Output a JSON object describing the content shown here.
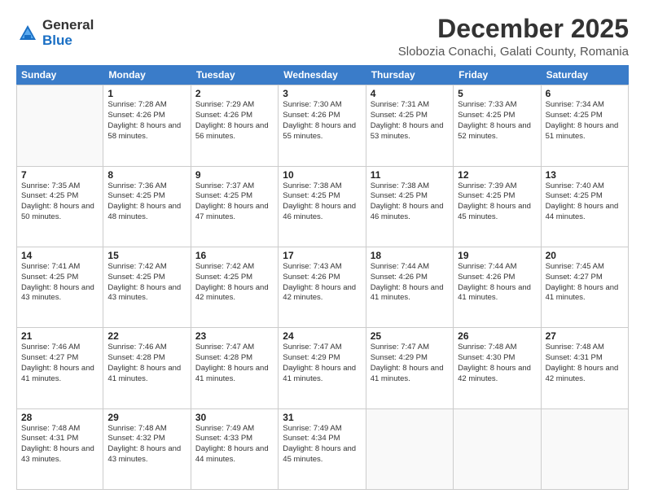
{
  "logo": {
    "general": "General",
    "blue": "Blue"
  },
  "title": "December 2025",
  "subtitle": "Slobozia Conachi, Galati County, Romania",
  "days": [
    "Sunday",
    "Monday",
    "Tuesday",
    "Wednesday",
    "Thursday",
    "Friday",
    "Saturday"
  ],
  "weeks": [
    [
      {
        "day": "",
        "sunrise": "",
        "sunset": "",
        "daylight": ""
      },
      {
        "day": "1",
        "sunrise": "Sunrise: 7:28 AM",
        "sunset": "Sunset: 4:26 PM",
        "daylight": "Daylight: 8 hours and 58 minutes."
      },
      {
        "day": "2",
        "sunrise": "Sunrise: 7:29 AM",
        "sunset": "Sunset: 4:26 PM",
        "daylight": "Daylight: 8 hours and 56 minutes."
      },
      {
        "day": "3",
        "sunrise": "Sunrise: 7:30 AM",
        "sunset": "Sunset: 4:26 PM",
        "daylight": "Daylight: 8 hours and 55 minutes."
      },
      {
        "day": "4",
        "sunrise": "Sunrise: 7:31 AM",
        "sunset": "Sunset: 4:25 PM",
        "daylight": "Daylight: 8 hours and 53 minutes."
      },
      {
        "day": "5",
        "sunrise": "Sunrise: 7:33 AM",
        "sunset": "Sunset: 4:25 PM",
        "daylight": "Daylight: 8 hours and 52 minutes."
      },
      {
        "day": "6",
        "sunrise": "Sunrise: 7:34 AM",
        "sunset": "Sunset: 4:25 PM",
        "daylight": "Daylight: 8 hours and 51 minutes."
      }
    ],
    [
      {
        "day": "7",
        "sunrise": "Sunrise: 7:35 AM",
        "sunset": "Sunset: 4:25 PM",
        "daylight": "Daylight: 8 hours and 50 minutes."
      },
      {
        "day": "8",
        "sunrise": "Sunrise: 7:36 AM",
        "sunset": "Sunset: 4:25 PM",
        "daylight": "Daylight: 8 hours and 48 minutes."
      },
      {
        "day": "9",
        "sunrise": "Sunrise: 7:37 AM",
        "sunset": "Sunset: 4:25 PM",
        "daylight": "Daylight: 8 hours and 47 minutes."
      },
      {
        "day": "10",
        "sunrise": "Sunrise: 7:38 AM",
        "sunset": "Sunset: 4:25 PM",
        "daylight": "Daylight: 8 hours and 46 minutes."
      },
      {
        "day": "11",
        "sunrise": "Sunrise: 7:38 AM",
        "sunset": "Sunset: 4:25 PM",
        "daylight": "Daylight: 8 hours and 46 minutes."
      },
      {
        "day": "12",
        "sunrise": "Sunrise: 7:39 AM",
        "sunset": "Sunset: 4:25 PM",
        "daylight": "Daylight: 8 hours and 45 minutes."
      },
      {
        "day": "13",
        "sunrise": "Sunrise: 7:40 AM",
        "sunset": "Sunset: 4:25 PM",
        "daylight": "Daylight: 8 hours and 44 minutes."
      }
    ],
    [
      {
        "day": "14",
        "sunrise": "Sunrise: 7:41 AM",
        "sunset": "Sunset: 4:25 PM",
        "daylight": "Daylight: 8 hours and 43 minutes."
      },
      {
        "day": "15",
        "sunrise": "Sunrise: 7:42 AM",
        "sunset": "Sunset: 4:25 PM",
        "daylight": "Daylight: 8 hours and 43 minutes."
      },
      {
        "day": "16",
        "sunrise": "Sunrise: 7:42 AM",
        "sunset": "Sunset: 4:25 PM",
        "daylight": "Daylight: 8 hours and 42 minutes."
      },
      {
        "day": "17",
        "sunrise": "Sunrise: 7:43 AM",
        "sunset": "Sunset: 4:26 PM",
        "daylight": "Daylight: 8 hours and 42 minutes."
      },
      {
        "day": "18",
        "sunrise": "Sunrise: 7:44 AM",
        "sunset": "Sunset: 4:26 PM",
        "daylight": "Daylight: 8 hours and 41 minutes."
      },
      {
        "day": "19",
        "sunrise": "Sunrise: 7:44 AM",
        "sunset": "Sunset: 4:26 PM",
        "daylight": "Daylight: 8 hours and 41 minutes."
      },
      {
        "day": "20",
        "sunrise": "Sunrise: 7:45 AM",
        "sunset": "Sunset: 4:27 PM",
        "daylight": "Daylight: 8 hours and 41 minutes."
      }
    ],
    [
      {
        "day": "21",
        "sunrise": "Sunrise: 7:46 AM",
        "sunset": "Sunset: 4:27 PM",
        "daylight": "Daylight: 8 hours and 41 minutes."
      },
      {
        "day": "22",
        "sunrise": "Sunrise: 7:46 AM",
        "sunset": "Sunset: 4:28 PM",
        "daylight": "Daylight: 8 hours and 41 minutes."
      },
      {
        "day": "23",
        "sunrise": "Sunrise: 7:47 AM",
        "sunset": "Sunset: 4:28 PM",
        "daylight": "Daylight: 8 hours and 41 minutes."
      },
      {
        "day": "24",
        "sunrise": "Sunrise: 7:47 AM",
        "sunset": "Sunset: 4:29 PM",
        "daylight": "Daylight: 8 hours and 41 minutes."
      },
      {
        "day": "25",
        "sunrise": "Sunrise: 7:47 AM",
        "sunset": "Sunset: 4:29 PM",
        "daylight": "Daylight: 8 hours and 41 minutes."
      },
      {
        "day": "26",
        "sunrise": "Sunrise: 7:48 AM",
        "sunset": "Sunset: 4:30 PM",
        "daylight": "Daylight: 8 hours and 42 minutes."
      },
      {
        "day": "27",
        "sunrise": "Sunrise: 7:48 AM",
        "sunset": "Sunset: 4:31 PM",
        "daylight": "Daylight: 8 hours and 42 minutes."
      }
    ],
    [
      {
        "day": "28",
        "sunrise": "Sunrise: 7:48 AM",
        "sunset": "Sunset: 4:31 PM",
        "daylight": "Daylight: 8 hours and 43 minutes."
      },
      {
        "day": "29",
        "sunrise": "Sunrise: 7:48 AM",
        "sunset": "Sunset: 4:32 PM",
        "daylight": "Daylight: 8 hours and 43 minutes."
      },
      {
        "day": "30",
        "sunrise": "Sunrise: 7:49 AM",
        "sunset": "Sunset: 4:33 PM",
        "daylight": "Daylight: 8 hours and 44 minutes."
      },
      {
        "day": "31",
        "sunrise": "Sunrise: 7:49 AM",
        "sunset": "Sunset: 4:34 PM",
        "daylight": "Daylight: 8 hours and 45 minutes."
      },
      {
        "day": "",
        "sunrise": "",
        "sunset": "",
        "daylight": ""
      },
      {
        "day": "",
        "sunrise": "",
        "sunset": "",
        "daylight": ""
      },
      {
        "day": "",
        "sunrise": "",
        "sunset": "",
        "daylight": ""
      }
    ]
  ]
}
